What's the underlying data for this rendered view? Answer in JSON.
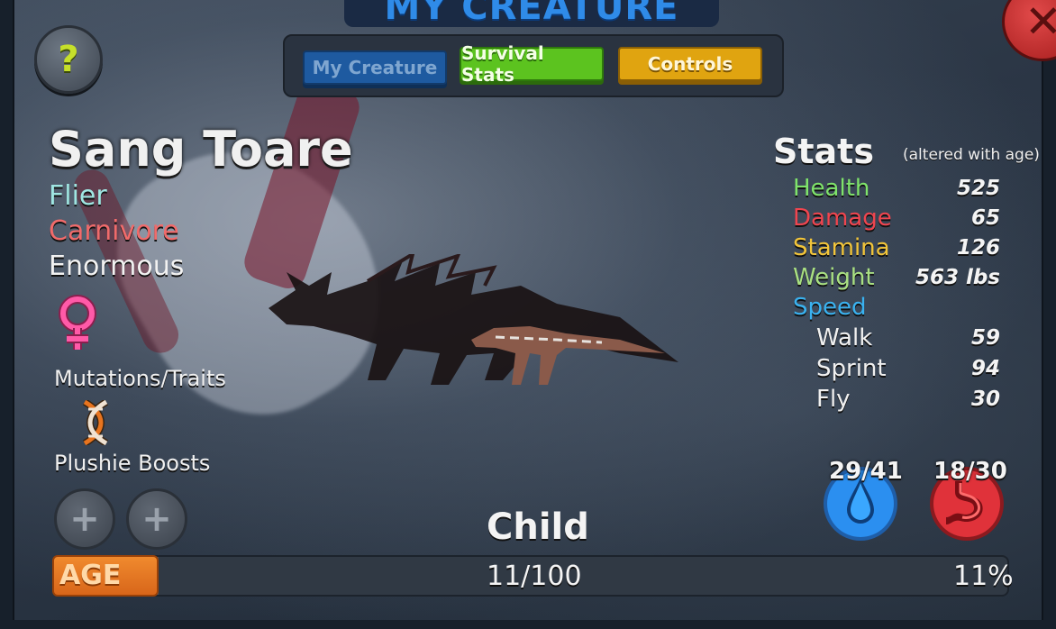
{
  "window": {
    "title": "MY CREATURE"
  },
  "tabs": [
    {
      "label": "My Creature"
    },
    {
      "label": "Survival Stats"
    },
    {
      "label": "Controls"
    }
  ],
  "help": {
    "label": "?",
    "icon": "question-mark-icon"
  },
  "close": {
    "label": "✕",
    "icon": "close-icon"
  },
  "creature": {
    "name": "Sang Toare",
    "traits": [
      "Flier",
      "Carnivore",
      "Enormous"
    ],
    "gender_icon": "female-icon",
    "mutations_label": "Mutations/Traits",
    "plushie_label": "Plushie Boosts"
  },
  "stats": {
    "title": "Stats",
    "note": "(altered with age)",
    "rows": [
      {
        "name": "Health",
        "value": "525",
        "color": "#7fe36b"
      },
      {
        "name": "Damage",
        "value": "65",
        "color": "#f0454f"
      },
      {
        "name": "Stamina",
        "value": "126",
        "color": "#f2c53a"
      },
      {
        "name": "Weight",
        "value": "563 lbs",
        "color": "#a9e082"
      },
      {
        "name": "Speed",
        "value": "",
        "color": "#3ab2f0"
      },
      {
        "name": "Walk",
        "value": "59"
      },
      {
        "name": "Sprint",
        "value": "94"
      },
      {
        "name": "Fly",
        "value": "30"
      }
    ]
  },
  "meters": {
    "water": {
      "label": "29/41",
      "icon": "water-drop-icon",
      "color": "#2b8ff0",
      "current": 29,
      "max": 41
    },
    "food": {
      "label": "18/30",
      "icon": "stomach-icon",
      "color": "#e0323a",
      "current": 18,
      "max": 30
    }
  },
  "age": {
    "stage": "Child",
    "tag": "AGE",
    "value": "11/100",
    "percent_label": "11%",
    "progress": 0.11
  }
}
